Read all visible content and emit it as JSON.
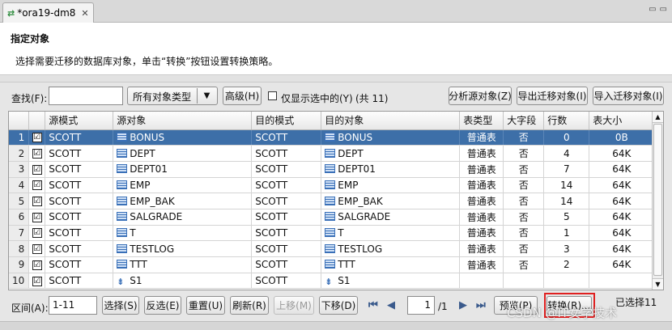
{
  "tab": {
    "title": "*ora19-dm8",
    "close": "✕"
  },
  "header": {
    "title": "指定对象",
    "description": "选择需要迁移的数据库对象，单击“转换”按钮设置转换策略。"
  },
  "toolbar": {
    "find_label": "查找(F):",
    "find_value": "",
    "object_type": "所有对象类型",
    "advanced": "高级(H)",
    "only_selected": "仅显示选中的(Y)",
    "count": "(共 11)",
    "analyze": "分析源对象(Z)",
    "export": "导出迁移对象(I)",
    "import": "导入迁移对象(I)"
  },
  "grid": {
    "columns": [
      "",
      "",
      "源模式",
      "源对象",
      "目的模式",
      "目的对象",
      "表类型",
      "大字段",
      "行数",
      "表大小"
    ],
    "rows": [
      {
        "n": "1",
        "checked": "☑",
        "src_schema": "SCOTT",
        "src_obj": "BONUS",
        "dst_schema": "SCOTT",
        "dst_obj": "BONUS",
        "type": "普通表",
        "lob": "否",
        "rows": "0",
        "size": "0B",
        "icon": "table"
      },
      {
        "n": "2",
        "checked": "☑",
        "src_schema": "SCOTT",
        "src_obj": "DEPT",
        "dst_schema": "SCOTT",
        "dst_obj": "DEPT",
        "type": "普通表",
        "lob": "否",
        "rows": "4",
        "size": "64K",
        "icon": "table"
      },
      {
        "n": "3",
        "checked": "☑",
        "src_schema": "SCOTT",
        "src_obj": "DEPT01",
        "dst_schema": "SCOTT",
        "dst_obj": "DEPT01",
        "type": "普通表",
        "lob": "否",
        "rows": "7",
        "size": "64K",
        "icon": "table"
      },
      {
        "n": "4",
        "checked": "☑",
        "src_schema": "SCOTT",
        "src_obj": "EMP",
        "dst_schema": "SCOTT",
        "dst_obj": "EMP",
        "type": "普通表",
        "lob": "否",
        "rows": "14",
        "size": "64K",
        "icon": "table"
      },
      {
        "n": "5",
        "checked": "☑",
        "src_schema": "SCOTT",
        "src_obj": "EMP_BAK",
        "dst_schema": "SCOTT",
        "dst_obj": "EMP_BAK",
        "type": "普通表",
        "lob": "否",
        "rows": "14",
        "size": "64K",
        "icon": "table"
      },
      {
        "n": "6",
        "checked": "☑",
        "src_schema": "SCOTT",
        "src_obj": "SALGRADE",
        "dst_schema": "SCOTT",
        "dst_obj": "SALGRADE",
        "type": "普通表",
        "lob": "否",
        "rows": "5",
        "size": "64K",
        "icon": "table"
      },
      {
        "n": "7",
        "checked": "☑",
        "src_schema": "SCOTT",
        "src_obj": "T",
        "dst_schema": "SCOTT",
        "dst_obj": "T",
        "type": "普通表",
        "lob": "否",
        "rows": "1",
        "size": "64K",
        "icon": "table"
      },
      {
        "n": "8",
        "checked": "☑",
        "src_schema": "SCOTT",
        "src_obj": "TESTLOG",
        "dst_schema": "SCOTT",
        "dst_obj": "TESTLOG",
        "type": "普通表",
        "lob": "否",
        "rows": "3",
        "size": "64K",
        "icon": "table"
      },
      {
        "n": "9",
        "checked": "☑",
        "src_schema": "SCOTT",
        "src_obj": "TTT",
        "dst_schema": "SCOTT",
        "dst_obj": "TTT",
        "type": "普通表",
        "lob": "否",
        "rows": "2",
        "size": "64K",
        "icon": "table"
      },
      {
        "n": "10",
        "checked": "☑",
        "src_schema": "SCOTT",
        "src_obj": "S1",
        "dst_schema": "SCOTT",
        "dst_obj": "S1",
        "type": "",
        "lob": "",
        "rows": "",
        "size": "",
        "icon": "sequence"
      }
    ]
  },
  "bottom": {
    "range_label": "区间(A):",
    "range_value": "1-11",
    "select": "选择(S)",
    "invert": "反选(E)",
    "reset": "重置(U)",
    "refresh": "刷新(R)",
    "move_up": "上移(M)",
    "move_down": "下移(D)",
    "page_value": "1",
    "page_total": "/1",
    "preview": "预览(P)",
    "convert": "转换(R)...",
    "selected_info": "已选择11"
  },
  "watermark": "CSDN @IT女学技术",
  "colors": {
    "selection": "#3d6fa8",
    "highlight": "#e02020"
  }
}
